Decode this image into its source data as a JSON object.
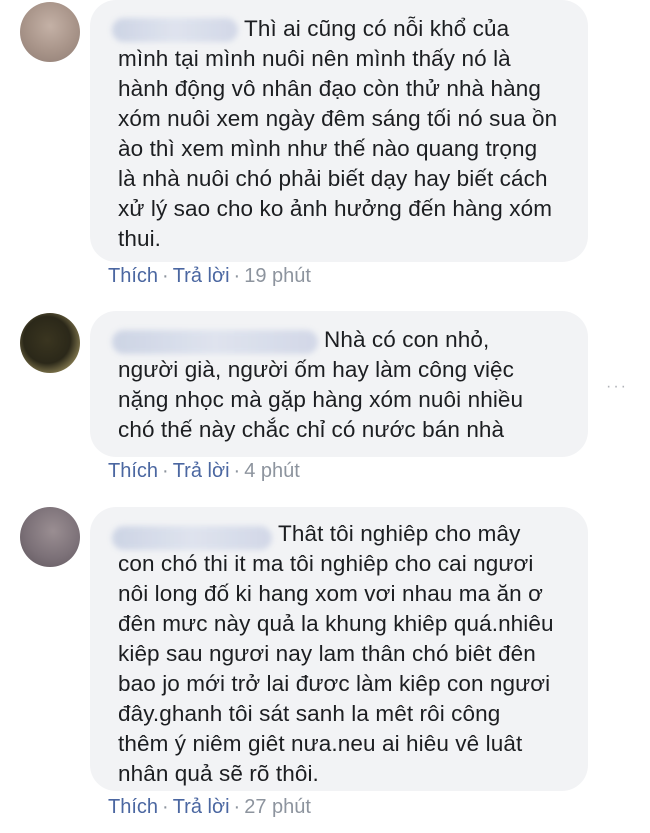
{
  "comments": [
    {
      "text": "Thì ai cũng có nỗi khổ của\nmình tại mình nuôi nên mình thấy nó là\nhành động vô nhân đạo còn thử nhà hàng\nxóm nuôi xem ngày đêm sáng tối nó sua ồn\nào thì xem mình như thế nào quang trọng\nlà nhà nuôi chó phải biết dạy hay biết cách\nxử lý sao cho ko ảnh hưởng đến hàng xóm\nthui.",
      "like_label": "Thích",
      "reply_label": "Trả lời",
      "time": "19 phút"
    },
    {
      "text": "Nhà có con nhỏ,\nngười già, người ốm hay làm công việc\nnặng nhọc mà gặp hàng xóm nuôi nhiều\nchó thế này chắc chỉ có nước bán nhà",
      "like_label": "Thích",
      "reply_label": "Trả lời",
      "time": "4 phút"
    },
    {
      "text": "Thât tôi nghiêp cho mây\ncon chó thi it ma tôi nghiêp cho cai ngươi\nnôi long đố ki hang xom vơi nhau ma ăn ơ\nđên mưc này quả la khung khiêp quá.nhiêu\nkiêp sau ngươi nay lam thân chó biêt đên\nbao jo mới trở lai đươc làm kiêp con ngươi\nđây.ghanh tôi sát sanh la mêt rôi công\nthêm ý niêm giêt nưa.neu ai hiêu vê luât\nnhân quả sẽ rõ thôi.",
      "like_label": "Thích",
      "reply_label": "Trả lời",
      "time": "27 phút"
    }
  ],
  "more_options": "···"
}
